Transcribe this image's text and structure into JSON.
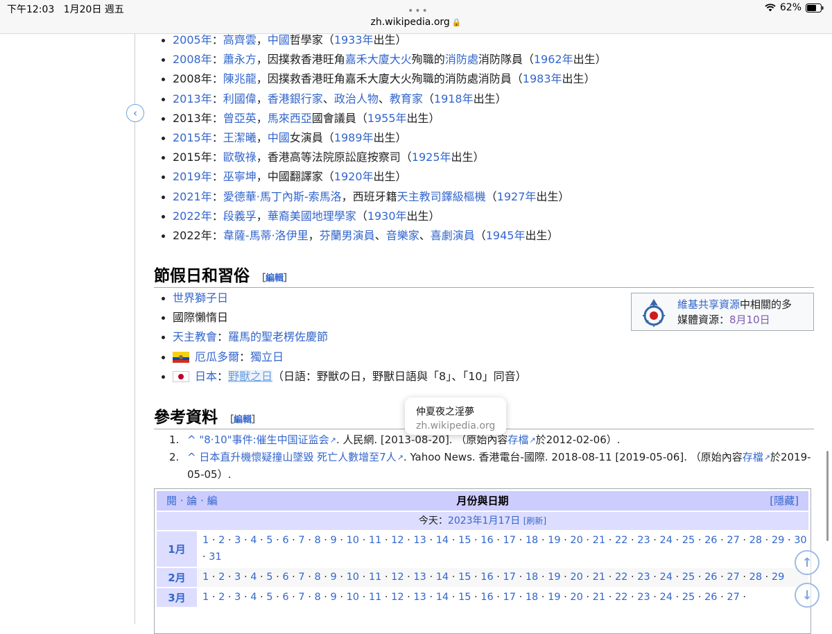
{
  "status": {
    "time": "下午12:03",
    "date": "1月20日 週五",
    "battery": "62%",
    "url": "zh.wikipedia.org"
  },
  "deaths": [
    {
      "year": "2005年",
      "text": [
        {
          "t": "高齊雲",
          "l": 1
        },
        {
          "t": "，"
        },
        {
          "t": "中國",
          "l": 1
        },
        {
          "t": "哲學家（"
        },
        {
          "t": "1933年",
          "l": 1
        },
        {
          "t": "出生）"
        }
      ],
      "year_link": true
    },
    {
      "year": "2008年",
      "year_link": true,
      "text": [
        {
          "t": "蕭永方",
          "l": 1
        },
        {
          "t": "，因撲救香港旺角"
        },
        {
          "t": "嘉禾大廈大火",
          "l": 1
        },
        {
          "t": "殉職的"
        },
        {
          "t": "消防處",
          "l": 1
        },
        {
          "t": "消防隊員（"
        },
        {
          "t": "1962年",
          "l": 1
        },
        {
          "t": "出生）"
        }
      ]
    },
    {
      "year": "2008年",
      "year_link": false,
      "text": [
        {
          "t": "陳兆龍",
          "l": 1
        },
        {
          "t": "，因撲救香港旺角嘉禾大廈大火殉職的消防處消防員（"
        },
        {
          "t": "1983年",
          "l": 1
        },
        {
          "t": "出生）"
        }
      ]
    },
    {
      "year": "2013年",
      "year_link": true,
      "text": [
        {
          "t": "利國偉",
          "l": 1
        },
        {
          "t": "，"
        },
        {
          "t": "香港",
          "l": 1
        },
        {
          "t": "銀行家",
          "l": 1
        },
        {
          "t": "、"
        },
        {
          "t": "政治人物",
          "l": 1
        },
        {
          "t": "、"
        },
        {
          "t": "教育家",
          "l": 1
        },
        {
          "t": "（"
        },
        {
          "t": "1918年",
          "l": 1
        },
        {
          "t": "出生）"
        }
      ]
    },
    {
      "year": "2013年",
      "year_link": false,
      "text": [
        {
          "t": "曾亞英",
          "l": 1
        },
        {
          "t": "，"
        },
        {
          "t": "馬來西亞",
          "l": 1
        },
        {
          "t": "國會議員（"
        },
        {
          "t": "1955年",
          "l": 1
        },
        {
          "t": "出生）"
        }
      ]
    },
    {
      "year": "2015年",
      "year_link": true,
      "text": [
        {
          "t": "王潔曦",
          "l": 1
        },
        {
          "t": "，"
        },
        {
          "t": "中國",
          "l": 1
        },
        {
          "t": "女演員（"
        },
        {
          "t": "1989年",
          "l": 1
        },
        {
          "t": "出生）"
        }
      ]
    },
    {
      "year": "2015年",
      "year_link": false,
      "text": [
        {
          "t": "歐敬祿",
          "l": 1
        },
        {
          "t": "，香港高等法院原訟庭按察司（"
        },
        {
          "t": "1925年",
          "l": 1
        },
        {
          "t": "出生）"
        }
      ]
    },
    {
      "year": "2019年",
      "year_link": true,
      "text": [
        {
          "t": "巫寧坤",
          "l": 1
        },
        {
          "t": "，中國翻譯家（"
        },
        {
          "t": "1920年",
          "l": 1
        },
        {
          "t": "出生）"
        }
      ]
    },
    {
      "year": "2021年",
      "year_link": true,
      "text": [
        {
          "t": "愛德華·馬丁內斯-索馬洛",
          "l": 1
        },
        {
          "t": "，西班牙籍"
        },
        {
          "t": "天主教司鐸級樞機",
          "l": 1
        },
        {
          "t": "（"
        },
        {
          "t": "1927年",
          "l": 1
        },
        {
          "t": "出生）"
        }
      ]
    },
    {
      "year": "2022年",
      "year_link": true,
      "text": [
        {
          "t": "段義孚",
          "l": 1
        },
        {
          "t": "，"
        },
        {
          "t": "華裔美國地理學家",
          "l": 1
        },
        {
          "t": "（"
        },
        {
          "t": "1930年",
          "l": 1
        },
        {
          "t": "出生）"
        }
      ]
    },
    {
      "year": "2022年",
      "year_link": false,
      "text": [
        {
          "t": "韋薩-馬蒂·洛伊里",
          "l": 1
        },
        {
          "t": "，"
        },
        {
          "t": "芬蘭",
          "l": 1
        },
        {
          "t": "男演員",
          "l": 1
        },
        {
          "t": "、"
        },
        {
          "t": "音樂家",
          "l": 1
        },
        {
          "t": "、"
        },
        {
          "t": "喜劇演員",
          "l": 1
        },
        {
          "t": "（"
        },
        {
          "t": "1945年",
          "l": 1
        },
        {
          "t": "出生）"
        }
      ]
    }
  ],
  "holidays": {
    "heading": "節假日和習俗",
    "edit_open": "［",
    "edit_label": "編輯",
    "edit_close": "］",
    "items": {
      "lion_day": "世界獅子日",
      "lazy_day": "國際懶惰日",
      "catholic_prefix": "天主教會",
      "catholic_colon": "：",
      "catholic_feast": "羅馬的聖老楞佐慶節",
      "ecuador": "厄瓜多爾",
      "ecuador_colon": "：",
      "ecuador_day": "獨立日",
      "japan": "日本",
      "japan_colon": "：",
      "japan_day": "野獸之日",
      "japan_note": "（日語：野獣の日，野獸日語與「8」、「10」同音）"
    }
  },
  "commons": {
    "link": "維基共享資源",
    "text_a": "中相關的多",
    "text_b": "媒體資源：",
    "date": "8月10日"
  },
  "refs": {
    "heading": "參考資料",
    "items": [
      {
        "num": "1.",
        "caret": "^",
        "title": "\"8·10\"事件:催生中国证监会",
        "rest": ". 人民網. [2013-08-20]. （原始內容",
        "archive": "存檔",
        "tail": "於2012-02-06）."
      },
      {
        "num": "2.",
        "caret": "^",
        "title": "日本直升機懷疑撞山墜毀 死亡人數增至7人",
        "rest": ". Yahoo News. 香港電台-國際. 2018-08-11 [2019-05-06]. （原始內容",
        "archive": "存檔",
        "tail": "於2019-05-05）."
      }
    ]
  },
  "tooltip": {
    "title": "仲夏夜之淫夢",
    "domain": "zh.wikipedia.org"
  },
  "navbox": {
    "vde": "閱 · 論 · 編",
    "title": "月份與日期",
    "hide": "[隱藏]",
    "today_label": "今天：",
    "today_date": "2023年1月17日",
    "refresh": "[刷新]",
    "months": [
      {
        "label": "1月",
        "days": 31
      },
      {
        "label": "2月",
        "days": 29
      },
      {
        "label": "3月",
        "days": 27
      }
    ]
  }
}
